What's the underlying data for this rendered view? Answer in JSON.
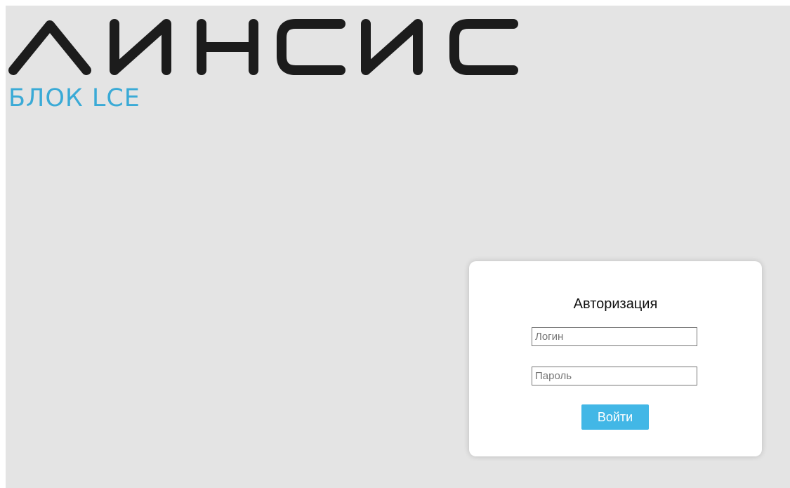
{
  "logo": {
    "title": "ЛИНСИС",
    "subtitle": "БЛОК LCE",
    "title_color": "#1c1c1c",
    "subtitle_color": "#3aaad6"
  },
  "login": {
    "title": "Авторизация",
    "login_placeholder": "Логин",
    "login_value": "",
    "password_placeholder": "Пароль",
    "password_value": "",
    "submit_label": "Войти",
    "button_color": "#42b7e6"
  },
  "colors": {
    "background": "#e4e4e4",
    "card": "#ffffff"
  }
}
